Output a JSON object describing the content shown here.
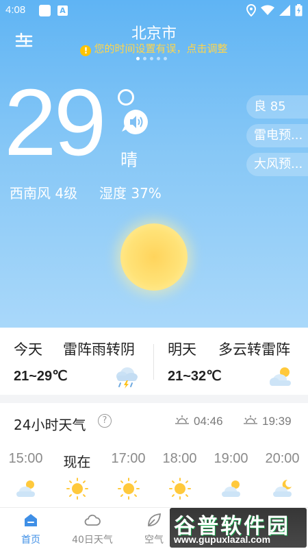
{
  "status_bar": {
    "time": "4:08"
  },
  "header": {
    "city": "北京市",
    "time_warning": "您的时间设置有误，点击调整",
    "page_count": 5,
    "active_page": 1
  },
  "current": {
    "temperature": "29",
    "condition": "晴",
    "wind": "西南风 4级",
    "humidity": "湿度 37%"
  },
  "pills": {
    "air_quality": "良 85",
    "thunder_warning": "雷电预...",
    "wind_warning": "大风预..."
  },
  "forecast": {
    "today": {
      "day": "今天",
      "desc": "雷阵雨转阴",
      "range": "21~29℃",
      "icon": "thunderstorm-icon"
    },
    "tomorrow": {
      "day": "明天",
      "desc": "多云转雷阵",
      "range": "21~32℃",
      "icon": "partly-cloudy-icon"
    }
  },
  "hourly": {
    "title": "24小时天气",
    "sunrise": "04:46",
    "sunset": "19:39",
    "hours": [
      {
        "time": "15:00",
        "icon": "partly-cloudy-icon"
      },
      {
        "time": "现在",
        "icon": "sunny-icon"
      },
      {
        "time": "17:00",
        "icon": "sunny-icon"
      },
      {
        "time": "18:00",
        "icon": "sunny-icon"
      },
      {
        "time": "19:00",
        "icon": "partly-cloudy-icon"
      },
      {
        "time": "20:00",
        "icon": "partly-cloudy-night-icon"
      }
    ]
  },
  "bottom_nav": {
    "home": "首页",
    "forty_day": "40日天气",
    "air": "空气"
  },
  "watermark": {
    "brand": "谷普软件园",
    "url": "www.gupuxlazal.com"
  },
  "colors": {
    "sky_top": "#5fb4f4",
    "sky_bottom": "#a9d8fa",
    "accent": "#3f8fe6",
    "warning": "#ffd54a"
  }
}
